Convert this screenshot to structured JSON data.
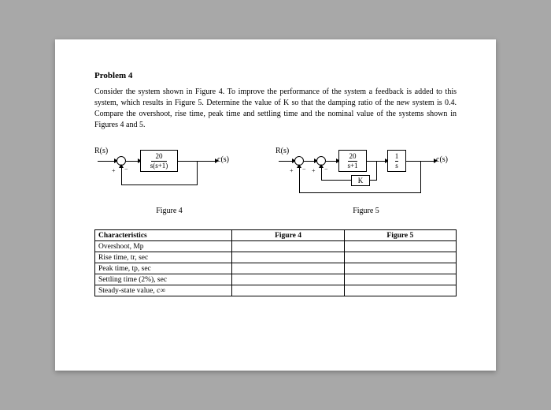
{
  "problem": {
    "title": "Problem 4",
    "text": "Consider the system shown in Figure 4. To improve the performance of the system a feedback is added to this system, which results in Figure 5. Determine the value of K so that the damping ratio of the new system is 0.4. Compare the overshoot, rise time, peak time and settling time and the nominal value of the systems shown in Figures 4 and 5."
  },
  "figures": {
    "fig4": {
      "caption": "Figure 4",
      "input": "R(s)",
      "output": "c(s)",
      "block_num": "20",
      "block_den": "s(s+1)"
    },
    "fig5": {
      "caption": "Figure 5",
      "input": "R(s)",
      "output": "c(s)",
      "block1_num": "20",
      "block1_den": "s+1",
      "block2_num": "1",
      "block2_den": "s",
      "feedback": "K"
    }
  },
  "table": {
    "header_char": "Characteristics",
    "header_fig4": "Figure 4",
    "header_fig5": "Figure 5",
    "rows": {
      "r0": "Overshoot, Mp",
      "r1": "Rise time, tr, sec",
      "r2": "Peak time, tp, sec",
      "r3": "Settling time (2%), sec",
      "r4": "Steady-state value, c∞"
    }
  },
  "signs": {
    "plus": "+",
    "minus": "−"
  }
}
